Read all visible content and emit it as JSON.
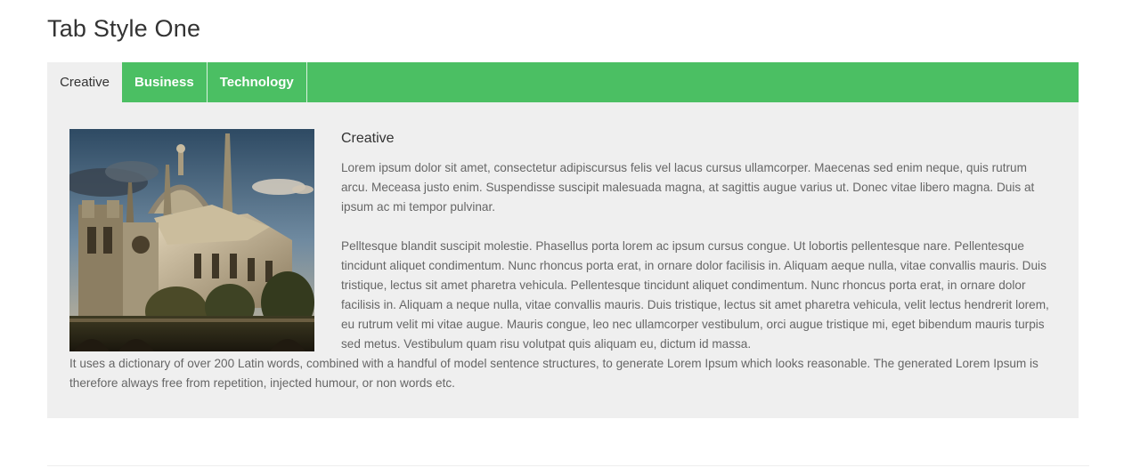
{
  "page": {
    "title": "Tab Style One"
  },
  "tabs": [
    {
      "label": "Creative",
      "active": true
    },
    {
      "label": "Business",
      "active": false
    },
    {
      "label": "Technology",
      "active": false
    }
  ],
  "panel": {
    "heading": "Creative",
    "image_alt": "cathedral illustration",
    "paragraphs": [
      "Lorem ipsum dolor sit amet, consectetur adipiscursus felis vel lacus cursus ullamcorper. Maecenas sed enim neque, quis rutrum arcu. Meceasa justo enim. Suspendisse suscipit malesuada magna, at sagittis augue varius ut. Donec vitae libero magna. Duis at ipsum ac mi tempor pulvinar.",
      "Pelltesque blandit suscipit molestie. Phasellus porta lorem ac ipsum cursus congue. Ut lobortis pellentesque nare. Pellentesque tincidunt aliquet condimentum. Nunc rhoncus porta erat, in ornare dolor facilisis in. Aliquam aeque nulla, vitae convallis mauris. Duis tristique, lectus sit amet pharetra vehicula. Pellentesque tincidunt aliquet condimentum. Nunc rhoncus porta erat, in ornare dolor facilisis in. Aliquam a neque nulla, vitae convallis mauris. Duis tristique, lectus sit amet pharetra vehicula, velit lectus hendrerit lorem, eu rutrum velit mi vitae augue. Mauris congue, leo nec ullamcorper vestibulum, orci augue tristique mi, eget bibendum mauris turpis sed metus. Vestibulum quam risu volutpat quis aliquam eu, dictum id massa.",
      "It uses a dictionary of over 200 Latin words, combined with a handful of model sentence structures, to generate Lorem Ipsum which looks reasonable. The generated Lorem Ipsum is therefore always free from repetition, injected humour, or non words etc."
    ]
  },
  "colors": {
    "tab_bar": "#4bbf63",
    "panel_bg": "#efefef",
    "title_text": "#333333",
    "body_text": "#666666"
  }
}
